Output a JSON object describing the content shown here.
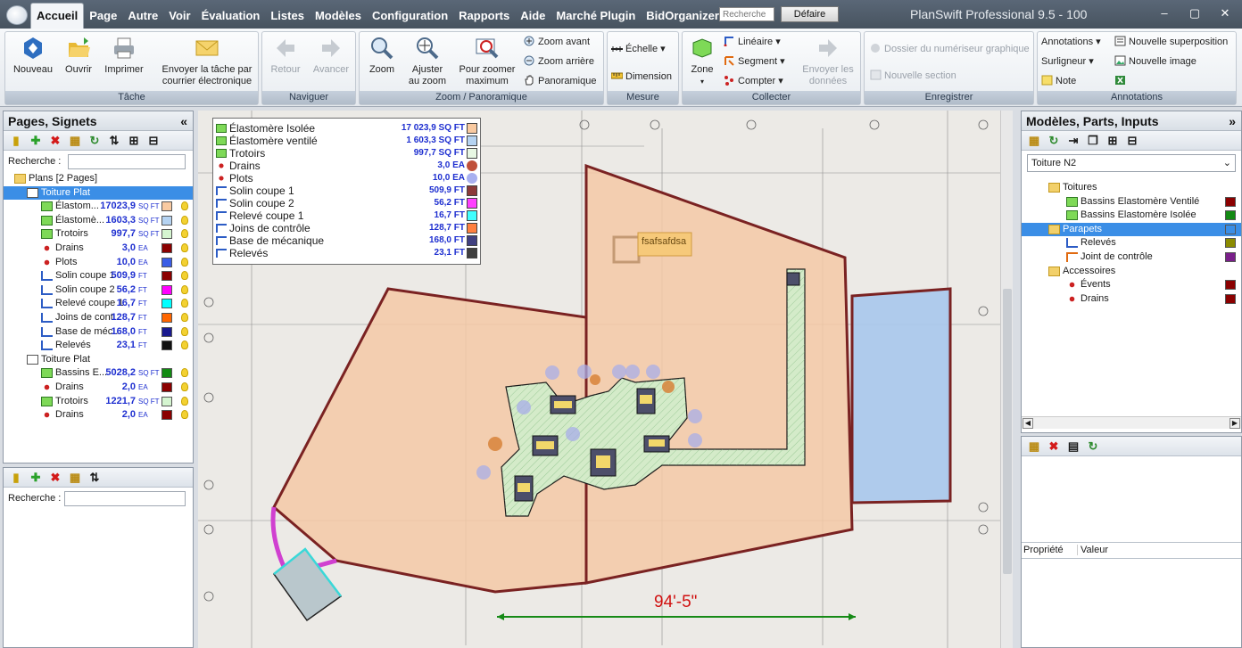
{
  "menu": {
    "tabs": [
      "Accueil",
      "Page",
      "Autre",
      "Voir",
      "Évaluation",
      "Listes",
      "Modèles",
      "Configuration",
      "Rapports",
      "Aide",
      "Marché Plugin",
      "BidOrganizer"
    ],
    "active": "Accueil",
    "search_placeholder": "Recherche",
    "undo_label": "Défaire",
    "app_title": "PlanSwift Professional 9.5 - 100"
  },
  "ribbon": {
    "tache": {
      "title": "Tâche",
      "nouveau": "Nouveau",
      "ouvrir": "Ouvrir",
      "imprimer": "Imprimer",
      "envoyer_1": "Envoyer la tâche par",
      "envoyer_2": "courrier électronique"
    },
    "naviguer": {
      "title": "Naviguer",
      "retour": "Retour",
      "avancer": "Avancer"
    },
    "zoom": {
      "title": "Zoom / Panoramique",
      "zoom": "Zoom",
      "ajuster_1": "Ajuster",
      "ajuster_2": "au zoom",
      "max_1": "Pour zoomer",
      "max_2": "maximum",
      "avant": "Zoom avant",
      "arriere": "Zoom arrière",
      "pano": "Panoramique"
    },
    "mesure": {
      "title": "Mesure",
      "echelle": "Échelle",
      "dimension": "Dimension"
    },
    "collecter": {
      "title": "Collecter",
      "zone": "Zone",
      "lineaire": "Linéaire",
      "segment": "Segment",
      "compter": "Compter",
      "envoyer_1": "Envoyer les",
      "envoyer_2": "données"
    },
    "enregistrer": {
      "title": "Enregistrer",
      "dossier": "Dossier du numériseur graphique",
      "section": "Nouvelle section"
    },
    "annotations": {
      "title": "Annotations",
      "annotations": "Annotations",
      "surligneur": "Surligneur",
      "note": "Note",
      "superposition": "Nouvelle superposition",
      "image": "Nouvelle image"
    }
  },
  "left_panel": {
    "title": "Pages, Signets",
    "search_label": "Recherche :",
    "root": "Plans [2 Pages]",
    "page1": "Toiture Plat",
    "page1_items": [
      {
        "name": "Élastom...",
        "value": "17023,9",
        "unit": "SQ FT",
        "color": "#f9caa1"
      },
      {
        "name": "Élastomè...",
        "value": "1603,3",
        "unit": "SQ FT",
        "color": "#b5d3f2"
      },
      {
        "name": "Trotoirs",
        "value": "997,7",
        "unit": "SQ FT",
        "color": "#d5f5d0"
      },
      {
        "name": "Drains",
        "value": "3,0",
        "unit": "EA",
        "color": "#8b0000"
      },
      {
        "name": "Plots",
        "value": "10,0",
        "unit": "EA",
        "color": "#3a5de6"
      },
      {
        "name": "Solin coupe 1",
        "value": "509,9",
        "unit": "FT",
        "color": "#8b0000"
      },
      {
        "name": "Solin coupe 2",
        "value": "56,2",
        "unit": "FT",
        "color": "#ff00ff"
      },
      {
        "name": "Relevé coupe 1",
        "value": "16,7",
        "unit": "FT",
        "color": "#00ffff"
      },
      {
        "name": "Joins de cont...",
        "value": "128,7",
        "unit": "FT",
        "color": "#ff6600"
      },
      {
        "name": "Base de méc...",
        "value": "168,0",
        "unit": "FT",
        "color": "#1a1a8f"
      },
      {
        "name": "Relevés",
        "value": "23,1",
        "unit": "FT",
        "color": "#111111"
      }
    ],
    "page2": "Toiture Plat",
    "page2_items": [
      {
        "name": "Bassins E...",
        "value": "5028,2",
        "unit": "SQ FT",
        "color": "#138a13"
      },
      {
        "name": "Drains",
        "value": "2,0",
        "unit": "EA",
        "color": "#8b0000"
      },
      {
        "name": "Trotoirs",
        "value": "1221,7",
        "unit": "SQ FT",
        "color": "#d5f5d0"
      },
      {
        "name": "Drains",
        "value": "2,0",
        "unit": "EA",
        "color": "#8b0000"
      }
    ],
    "search2_label": "Recherche :"
  },
  "legend": [
    {
      "name": "Élastomère Isolée",
      "value": "17 023,9 SQ FT",
      "color": "#f9caa1",
      "icon": "area"
    },
    {
      "name": "Élastomère ventilé",
      "value": "1 603,3 SQ FT",
      "color": "#b5d3f2",
      "icon": "area"
    },
    {
      "name": "Trotoirs",
      "value": "997,7 SQ FT",
      "color": "#e8f8e4",
      "icon": "area"
    },
    {
      "name": "Drains",
      "value": "3,0 EA",
      "color": "#c0503a",
      "icon": "count"
    },
    {
      "name": "Plots",
      "value": "10,0 EA",
      "color": "#a8b0f0",
      "icon": "count"
    },
    {
      "name": "Solin coupe 1",
      "value": "509,9 FT",
      "color": "#8b3a3a",
      "icon": "linear"
    },
    {
      "name": "Solin coupe 2",
      "value": "56,2 FT",
      "color": "#ff40ff",
      "icon": "linear"
    },
    {
      "name": "Relevé coupe 1",
      "value": "16,7 FT",
      "color": "#40ffff",
      "icon": "linear"
    },
    {
      "name": "Joins de contrôle",
      "value": "128,7 FT",
      "color": "#ff8040",
      "icon": "linear"
    },
    {
      "name": "Base de mécanique",
      "value": "168,0 FT",
      "color": "#404080",
      "icon": "linear"
    },
    {
      "name": "Relevés",
      "value": "23,1 FT",
      "color": "#404040",
      "icon": "linear"
    }
  ],
  "canvas": {
    "dimension_text": "94'-5\"",
    "callout": "fsafsafdsa"
  },
  "right_panel": {
    "title": "Modèles, Parts, Inputs",
    "dropdown_value": "Toiture N2",
    "tree": [
      {
        "level": 1,
        "name": "Toitures",
        "type": "folder"
      },
      {
        "level": 2,
        "name": "Bassins Elastomère Ventilé",
        "type": "area",
        "color": "#8b0000"
      },
      {
        "level": 2,
        "name": "Bassins Elastomère Isolée",
        "type": "area",
        "color": "#138a13"
      },
      {
        "level": 1,
        "name": "Parapets",
        "type": "folder",
        "selected": true,
        "color": "#3b8ee6"
      },
      {
        "level": 2,
        "name": "Relevés",
        "type": "linear",
        "color": "#8b8b00"
      },
      {
        "level": 2,
        "name": "Joint de contrôle",
        "type": "segment",
        "color": "#7a1f8a"
      },
      {
        "level": 1,
        "name": "Accessoires",
        "type": "folder"
      },
      {
        "level": 2,
        "name": "Évents",
        "type": "count",
        "color": "#8b0000"
      },
      {
        "level": 2,
        "name": "Drains",
        "type": "count",
        "color": "#8b0000"
      }
    ],
    "prop_col1": "Propriété",
    "prop_col2": "Valeur"
  }
}
